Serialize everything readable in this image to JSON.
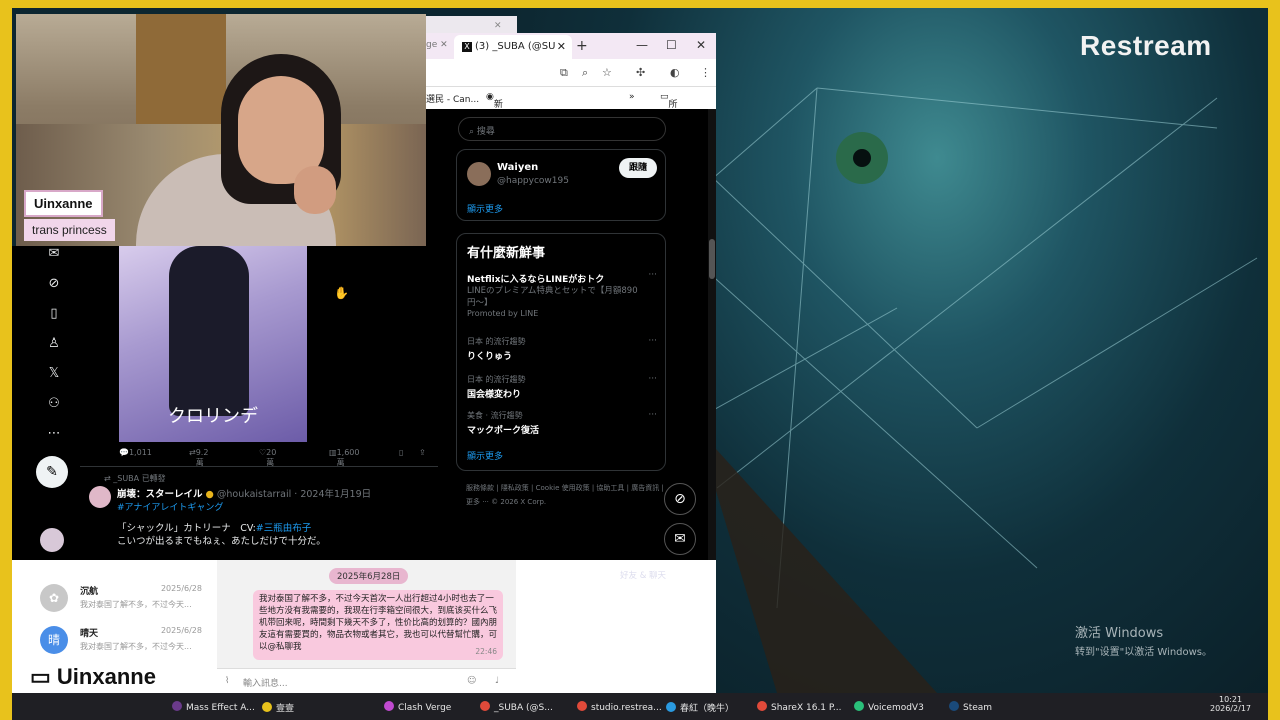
{
  "stream": {
    "brand": "Restream",
    "streamer_name": "Uinxanne",
    "streamer_tagline": "trans princess",
    "bottom_name": "Uinxanne"
  },
  "watermark": {
    "line1": "激活 Windows",
    "line2": "转到\"设置\"以激活 Windows。"
  },
  "browser": {
    "tab_title": "(3) _SUBA (@SU",
    "bookmarks": [
      "選民 - Can...",
      "新分頁",
      "所有书签"
    ],
    "colors": {
      "accent": "#1d9bf0",
      "bg": "#000000"
    }
  },
  "x_right": {
    "search_placeholder": "搜尋",
    "who_to_follow": {
      "name": "Waiyen",
      "handle": "@happycow195",
      "follow_label": "跟隨"
    },
    "show_more_1": "顯示更多",
    "trends_title": "有什麼新鮮事",
    "promo": {
      "title": "Netflixに入るならLINEがおトク",
      "desc": "LINEのプレミアム特典とセットで【月額890円〜】",
      "promoted": "Promoted by LINE"
    },
    "trends": [
      {
        "context": "日本 的流行趨勢",
        "title": "りくりゅう"
      },
      {
        "context": "日本 的流行趨勢",
        "title": "国会様変わり"
      },
      {
        "context": "美食 · 流行趨勢",
        "title": "マックポーク復活"
      }
    ],
    "show_more_2": "顯示更多",
    "footer": [
      "服務條款",
      "隱私政策",
      "Cookie 使用政策",
      "協助工具",
      "廣告資訊",
      "更多 ···",
      "© 2026 X Corp."
    ]
  },
  "x_left": {
    "image_caption": "クロリンデ",
    "actions": {
      "replies": "1,011",
      "reposts": "9.2萬",
      "likes": "20萬",
      "views": "1,600萬"
    },
    "retweeted_by": "_SUBA 已轉發",
    "tweet": {
      "author": "崩壊：スターレイル",
      "handle": "@houkaistarrail · 2024年1月19日",
      "hashtag": "#アナイアレイトギャング",
      "line1_prefix": "「シャックル」カトリーナ　CV:",
      "line1_link": "#三瓶由布子",
      "line2": "こいつが出るまでもねぇ、あたしだけで十分だ。"
    }
  },
  "chat": {
    "date": "2025年6月28日",
    "contacts": [
      {
        "name": "沉航",
        "date": "2025/6/28",
        "preview": "我对泰国了解不多，不过今天..."
      },
      {
        "name": "晴天",
        "date": "2025/6/28",
        "preview": "我对泰国了解不多，不过今天..."
      }
    ],
    "message": "我对泰国了解不多，不过今天首次一人出行超过4小时也去了一些地方没有我需要的，我现在行李箱空间很大，到底该买什么飞机带回来呢，時間剩下幾天不多了，性价比高的划算的？國內朋友這有需要買的，物品衣物或者其它，我也可以代替幫忙購，可以@私聊我",
    "message_time": "22:46",
    "input_placeholder": "輸入訊息...",
    "friends_label": "好友 & 聊天"
  },
  "taskbar": {
    "items": [
      "Mass Effect A...",
      "壹壹",
      "Clash Verge",
      "_SUBA (@S...",
      "studio.restrea...",
      "春紅（晚牛）",
      "ShareX 16.1 P...",
      "VoicemodV3",
      "Steam"
    ],
    "time": "10:21",
    "date": "2026/2/17"
  }
}
